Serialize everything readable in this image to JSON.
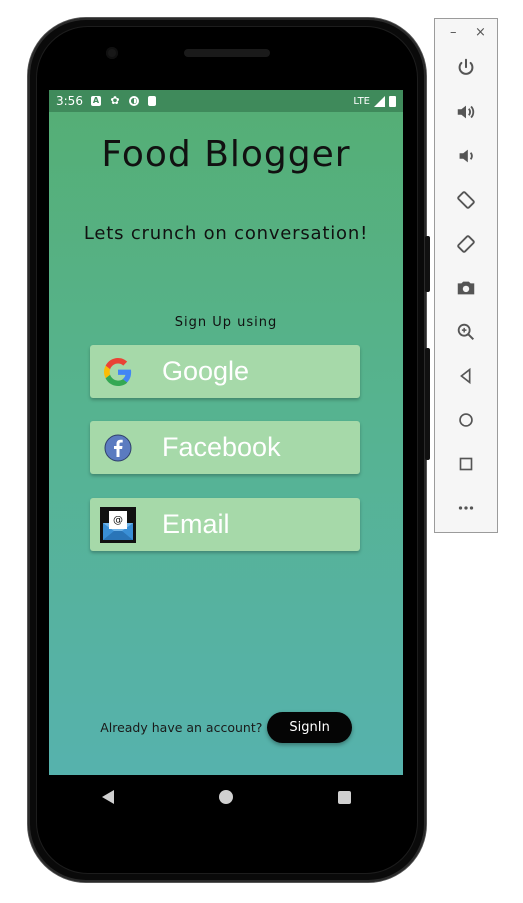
{
  "status_bar": {
    "time": "3:56",
    "network": "LTE"
  },
  "app": {
    "title": "Food Blogger",
    "tagline": "Lets crunch on conversation!",
    "signup_label": "Sign Up using",
    "buttons": [
      {
        "label": "Google",
        "icon": "google-icon"
      },
      {
        "label": "Facebook",
        "icon": "facebook-icon"
      },
      {
        "label": "Email",
        "icon": "email-icon"
      }
    ],
    "footer_question": "Already have an account?",
    "signin_label": "SignIn"
  },
  "colors": {
    "gradient_top": "#55ae74",
    "gradient_bottom": "#56b2ad",
    "button_bg": "#a6d9a9",
    "signin_bg": "#050505"
  },
  "emulator_panel": {
    "minimize": "–",
    "close": "×",
    "tools": [
      "power-icon",
      "volume-up-icon",
      "volume-down-icon",
      "rotate-left-icon",
      "rotate-right-icon",
      "camera-icon",
      "zoom-icon",
      "back-icon",
      "home-icon",
      "overview-icon",
      "more-icon"
    ]
  }
}
